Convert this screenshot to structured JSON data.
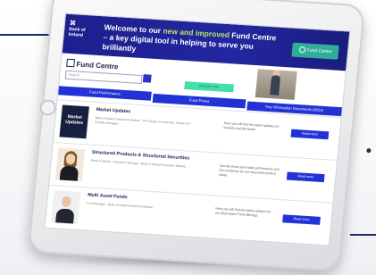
{
  "banner": {
    "logo_line1": "Bank of",
    "logo_line2": "Ireland",
    "headline_pre": "Welcome to our ",
    "headline_highlight": "new and improved",
    "headline_post": " Fund Centre – a key digital tool in helping to serve you brilliantly",
    "fund_centre_button": "Fund Centre"
  },
  "page": {
    "title": "Fund Centre",
    "search_placeholder": "Search",
    "green_label": "Discover more"
  },
  "tabs": [
    {
      "label": "Fund Performance"
    },
    {
      "label": "Fund Prices"
    },
    {
      "label": "Key Information Documents (KIDs)"
    }
  ],
  "rows": [
    {
      "thumb_text": "Market Updates",
      "title": "Market Updates",
      "sub": "Bank of Ireland Investment Markets · The Range of Investment, Assets and Portfolio Managers",
      "desc": "Here you will find the latest updates on markets and the funds",
      "button": "Read more"
    },
    {
      "title": "Structured Products & Structured Securities",
      "sub": "Bank of Ireland · Investment Manager · Bank of Ireland Investment Markets",
      "desc": "See the most up-to-date performance and the conditions for our structured product range",
      "button": "Read more"
    },
    {
      "title": "Multi Asset Funds",
      "sub": "Fund Manager · Bank of Ireland Investment Markets",
      "desc": "Here you will find the latest updates for our Multi Asset Fund offerings",
      "button": "Read more"
    }
  ],
  "colors": {
    "banner": "#1d1f8c",
    "accent_blue": "#2233d6",
    "accent_green": "#43e0a9",
    "highlight": "#b7e36a"
  }
}
